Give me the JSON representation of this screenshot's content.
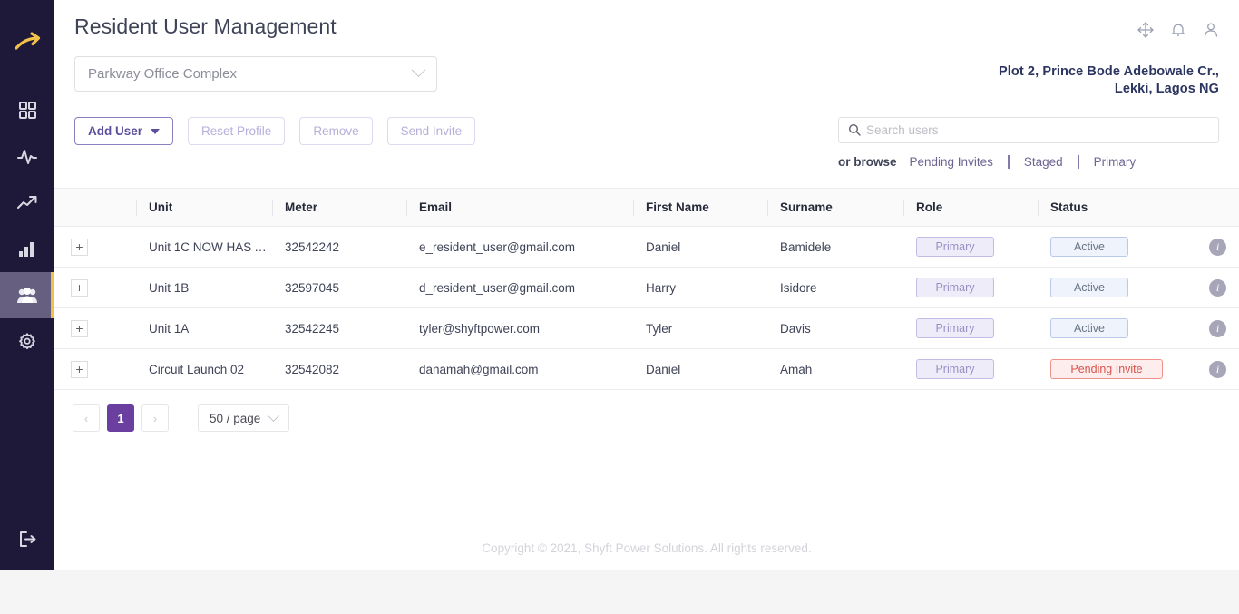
{
  "sidebar": {
    "logo_icon": "arrow-right-logo",
    "items": [
      {
        "icon": "grid-dashboard-icon",
        "name": "dashboard",
        "active": false
      },
      {
        "icon": "activity-pulse-icon",
        "name": "activity",
        "active": false
      },
      {
        "icon": "trending-up-icon",
        "name": "trends",
        "active": false
      },
      {
        "icon": "bar-chart-icon",
        "name": "reports",
        "active": false
      },
      {
        "icon": "users-group-icon",
        "name": "users",
        "active": true
      },
      {
        "icon": "gear-settings-icon",
        "name": "settings",
        "active": false
      }
    ],
    "logout_icon": "logout-icon"
  },
  "header": {
    "title": "Resident User Management",
    "icons": [
      {
        "name": "move-arrows-icon"
      },
      {
        "name": "bell-notification-icon"
      },
      {
        "name": "user-account-icon"
      }
    ]
  },
  "site_select": {
    "value": "Parkway Office Complex",
    "chevron_icon": "chevron-down-icon"
  },
  "address": {
    "line1": "Plot 2, Prince Bode Adebowale Cr.,",
    "line2": "Lekki, Lagos NG"
  },
  "toolbar": {
    "add_user_label": "Add User",
    "reset_profile_label": "Reset Profile",
    "remove_label": "Remove",
    "send_invite_label": "Send Invite"
  },
  "search": {
    "placeholder": "Search users",
    "value": "",
    "icon": "search-icon",
    "browse_label": "or browse",
    "links": [
      "Pending Invites",
      "Staged",
      "Primary"
    ]
  },
  "table": {
    "columns": [
      "",
      "Unit",
      "Meter",
      "Email",
      "First Name",
      "Surname",
      "Role",
      "Status",
      ""
    ],
    "expand_glyph": "+",
    "info_glyph": "i",
    "rows": [
      {
        "unit": "Unit 1C NOW HAS A …",
        "meter": "32542242",
        "email": "e_resident_user@gmail.com",
        "first_name": "Daniel",
        "surname": "Bamidele",
        "role": "Primary",
        "status": "Active",
        "status_kind": "active"
      },
      {
        "unit": "Unit 1B",
        "meter": "32597045",
        "email": "d_resident_user@gmail.com",
        "first_name": "Harry",
        "surname": "Isidore",
        "role": "Primary",
        "status": "Active",
        "status_kind": "active"
      },
      {
        "unit": "Unit 1A",
        "meter": "32542245",
        "email": "tyler@shyftpower.com",
        "first_name": "Tyler",
        "surname": "Davis",
        "role": "Primary",
        "status": "Active",
        "status_kind": "active"
      },
      {
        "unit": "Circuit Launch 02",
        "meter": "32542082",
        "email": "danamah@gmail.com",
        "first_name": "Daniel",
        "surname": "Amah",
        "role": "Primary",
        "status": "Pending Invite",
        "status_kind": "pending"
      }
    ]
  },
  "pagination": {
    "prev_glyph": "‹",
    "next_glyph": "›",
    "pages": [
      "1"
    ],
    "current_page": "1",
    "page_size_label": "50 / page"
  },
  "footer": {
    "text": "Copyright © 2021, Shyft Power Solutions. All rights reserved."
  },
  "colors": {
    "sidebar_bg": "#1e1839",
    "sidebar_active_bg": "#665f80",
    "accent_gold": "#f2c14a",
    "primary_purple": "#6a3fa0",
    "button_purple": "#5b4e9c",
    "pending_red": "#d8534c",
    "address_navy": "#2b3560"
  }
}
